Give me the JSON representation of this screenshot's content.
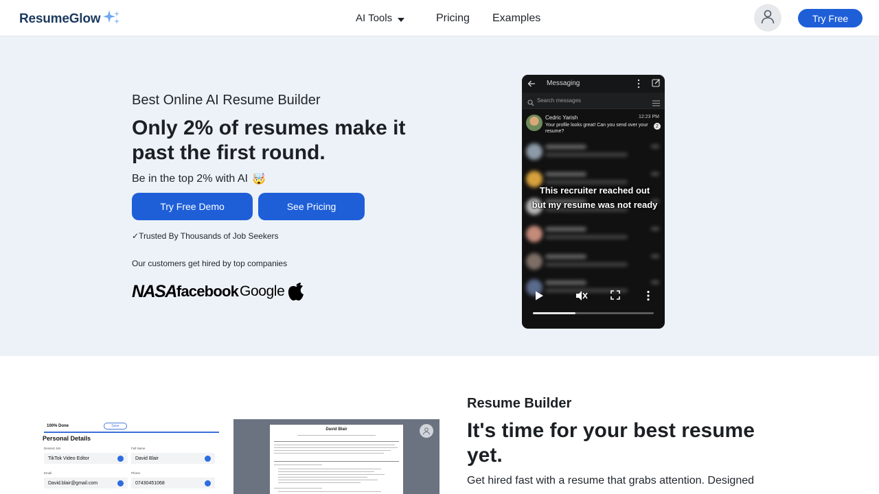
{
  "header": {
    "brand": "ResumeGlow",
    "nav": {
      "ai_tools": "AI Tools",
      "pricing": "Pricing",
      "examples": "Examples"
    },
    "try_free": "Try Free",
    "icons": [
      "sparkle-icon",
      "chevron-down-icon",
      "user-icon"
    ]
  },
  "hero": {
    "eyebrow": "Best Online AI Resume Builder",
    "title": "Only 2% of resumes make it past the first round.",
    "subtitle": "Be in the top 2% with AI",
    "subtitle_emoji": "🤯",
    "demo_button": "Try Free Demo",
    "pricing_button": "See Pricing",
    "trusted": "✓Trusted By Thousands of Job Seekers",
    "customers": "Our customers get hired by top companies",
    "company_logos": {
      "nasa": "NASA",
      "facebook": "facebook",
      "google": "Google",
      "apple": "apple-logo-icon"
    }
  },
  "video": {
    "app_title": "Messaging",
    "search_placeholder": "Search messages",
    "message": {
      "name": "Cedric Yarish",
      "time": "12:23 PM",
      "text": "Your profile looks great! Can you send over your resume?",
      "unread": "2"
    },
    "caption": "This recruiter reached out but my resume was not ready",
    "progress": 0.35,
    "controls": [
      "play-icon",
      "mute-icon",
      "fullscreen-icon",
      "more-vert-icon"
    ]
  },
  "feature": {
    "form": {
      "done": "100% Done",
      "save": "Save",
      "title": "Personal Details",
      "fields": [
        {
          "label": "Desired Job",
          "value": "TikTok Video Editor"
        },
        {
          "label": "Full Name",
          "value": "David Blair"
        },
        {
          "label": "Email",
          "value": "David.blair@gmail.com"
        },
        {
          "label": "Phone",
          "value": "07430451068"
        }
      ]
    },
    "preview_name": "David Blair",
    "eyebrow": "Resume Builder",
    "title": "It's time for your best resume yet.",
    "body": "Get hired fast with a resume that grabs attention. Designed"
  }
}
